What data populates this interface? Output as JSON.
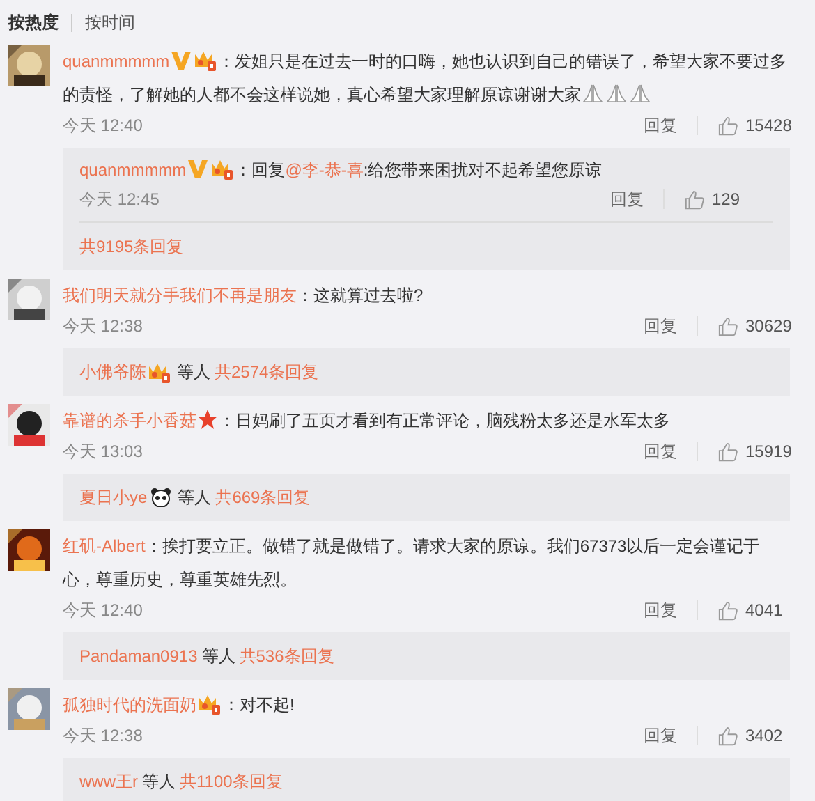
{
  "sort_tabs": [
    {
      "label": "按热度",
      "selected": true
    },
    {
      "label": "按时间",
      "selected": false
    }
  ],
  "comments": [
    {
      "user": "quanmmmmm",
      "badges": [
        {
          "kind": "v"
        },
        {
          "kind": "vip"
        }
      ],
      "text": "：发姐只是在过去一时的口嗨，她也认识到自己的错误了，希望大家不要过多的责怪，了解她的人都不会这样说她，真心希望大家理解原谅谢谢大家",
      "emoji": [
        {
          "kind": "pray"
        },
        {
          "kind": "pray"
        },
        {
          "kind": "pray"
        }
      ],
      "time": "今天 12:40",
      "reply": "回复",
      "likes": "15428",
      "sub_replies": [
        {
          "user": "quanmmmmm",
          "badges": [
            {
              "kind": "v"
            },
            {
              "kind": "vip"
            }
          ],
          "prefix": "：回复",
          "mention": "@李-恭-喜",
          "text": ":给您带来困扰对不起希望您原谅",
          "time": "今天 12:45",
          "reply": "回复",
          "likes": "129"
        }
      ],
      "more": {
        "total": "共9195条回复"
      }
    },
    {
      "user": "我们明天就分手我们不再是朋友",
      "text": "：这就算过去啦?",
      "time": "今天 12:38",
      "reply": "回复",
      "likes": "30629",
      "more": {
        "users": [
          {
            "name": "小佛爷陈",
            "badges": [
              {
                "kind": "vip"
              }
            ]
          }
        ],
        "others": "等人",
        "total": "共2574条回复"
      }
    },
    {
      "user": "靠谱的杀手小香菇",
      "badges": [
        {
          "kind": "star"
        }
      ],
      "text": "：日妈刷了五页才看到有正常评论，脑残粉太多还是水军太多",
      "time": "今天 13:03",
      "reply": "回复",
      "likes": "15919",
      "more": {
        "users": [
          {
            "name": "夏日小ye",
            "badges": [
              {
                "kind": "panda"
              }
            ]
          }
        ],
        "others": "等人",
        "total": "共669条回复"
      }
    },
    {
      "user": "红矶-Albert",
      "text": "：挨打要立正。做错了就是做错了。请求大家的原谅。我们67373以后一定会谨记于心，尊重历史，尊重英雄先烈。",
      "time": "今天 12:40",
      "reply": "回复",
      "likes": "4041",
      "more": {
        "users": [
          {
            "name": "Pandaman0913"
          }
        ],
        "others": "等人",
        "total": "共536条回复"
      }
    },
    {
      "user": "孤独时代的洗面奶",
      "badges": [
        {
          "kind": "vip"
        }
      ],
      "text": "：对不起!",
      "time": "今天 12:38",
      "reply": "回复",
      "likes": "3402",
      "more": {
        "users": [
          {
            "name": "www王r"
          }
        ],
        "others": "等人",
        "total": "共1100条回复"
      }
    }
  ]
}
